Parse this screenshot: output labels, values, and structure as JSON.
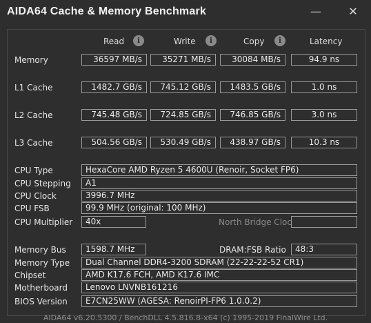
{
  "window": {
    "title": "AIDA64 Cache & Memory Benchmark",
    "minimize": "—",
    "close": "✕"
  },
  "columns": {
    "read": "Read",
    "write": "Write",
    "copy": "Copy",
    "latency": "Latency",
    "info_glyph": "i"
  },
  "rows": [
    {
      "label": "Memory",
      "read": "36597 MB/s",
      "write": "35271 MB/s",
      "copy": "30084 MB/s",
      "latency": "94.9 ns"
    },
    {
      "label": "L1 Cache",
      "read": "1482.7 GB/s",
      "write": "745.12 GB/s",
      "copy": "1483.5 GB/s",
      "latency": "1.0 ns"
    },
    {
      "label": "L2 Cache",
      "read": "745.48 GB/s",
      "write": "724.85 GB/s",
      "copy": "746.85 GB/s",
      "latency": "3.0 ns"
    },
    {
      "label": "L3 Cache",
      "read": "504.56 GB/s",
      "write": "530.49 GB/s",
      "copy": "438.97 GB/s",
      "latency": "10.3 ns"
    }
  ],
  "cpu": {
    "type_label": "CPU Type",
    "type": "HexaCore AMD Ryzen 5 4600U  (Renoir, Socket FP6)",
    "stepping_label": "CPU Stepping",
    "stepping": "A1",
    "clock_label": "CPU Clock",
    "clock": "3996.7 MHz",
    "fsb_label": "CPU FSB",
    "fsb": "99.9 MHz  (original: 100 MHz)",
    "multiplier_label": "CPU Multiplier",
    "multiplier": "40x",
    "north_bridge_label": "North Bridge Clock",
    "north_bridge": ""
  },
  "memory_info": {
    "bus_label": "Memory Bus",
    "bus": "1598.7 MHz",
    "ratio_label": "DRAM:FSB Ratio",
    "ratio": "48:3",
    "type_label": "Memory Type",
    "type": "Dual Channel DDR4-3200 SDRAM  (22-22-22-52 CR1)",
    "chipset_label": "Chipset",
    "chipset": "AMD K17.6 FCH, AMD K17.6 IMC",
    "motherboard_label": "Motherboard",
    "motherboard": "Lenovo LNVNB161216",
    "bios_label": "BIOS Version",
    "bios": "E7CN25WW  (AGESA: RenoirPI-FP6 1.0.0.2)"
  },
  "footer": "AIDA64 v6.20.5300 / BenchDLL 4.5.816.8-x64  (c) 1995-2019 FinalWire Ltd."
}
